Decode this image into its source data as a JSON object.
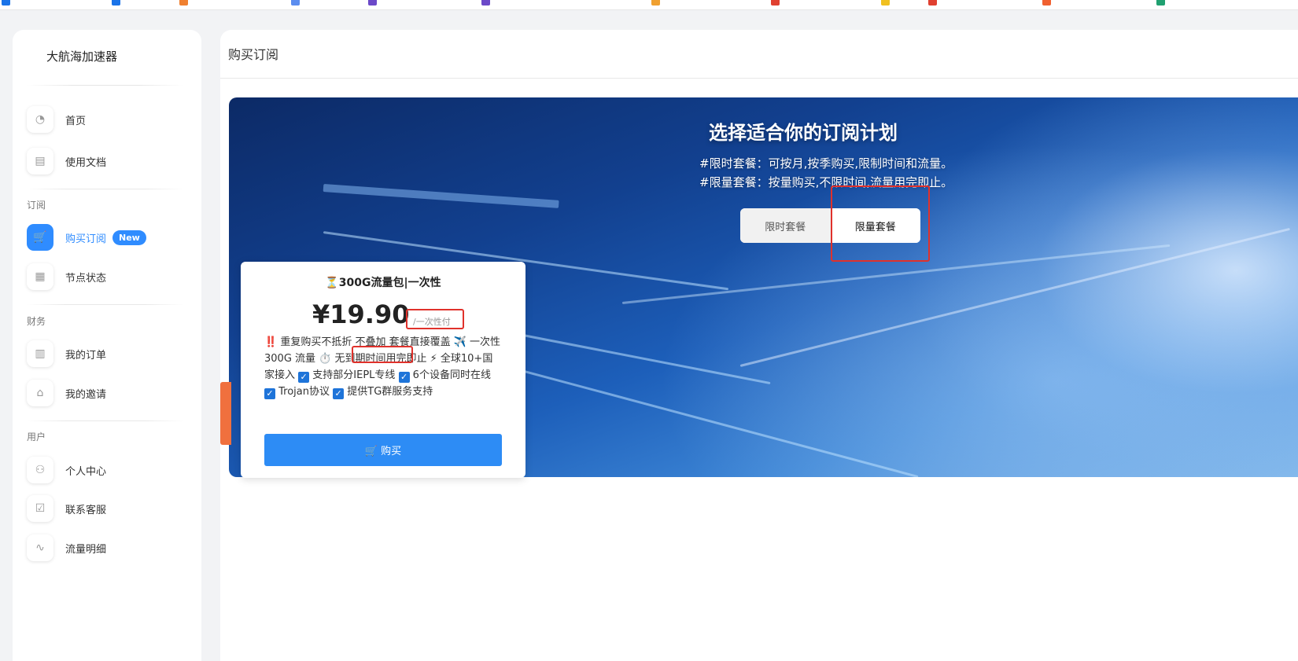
{
  "bookmarks": [
    {
      "color": "#1a73e8"
    },
    {
      "color": "#1a73e8"
    },
    {
      "color": "#f08030"
    },
    {
      "color": "#5b8def"
    },
    {
      "color": "#6b49c8"
    },
    {
      "color": "#6b49c8"
    },
    {
      "color": "#f0a030"
    },
    {
      "color": "#e04030"
    },
    {
      "color": "#f0c020"
    },
    {
      "color": "#e04030"
    },
    {
      "color": "#f06030"
    },
    {
      "color": "#20a070"
    }
  ],
  "sidebar": {
    "brand": "大航海加速器",
    "items_top": [
      {
        "label": "首页",
        "icon": "dashboard-icon",
        "glyph": "◔"
      },
      {
        "label": "使用文档",
        "icon": "document-icon",
        "glyph": "▤"
      }
    ],
    "sections": [
      {
        "title": "订阅",
        "items": [
          {
            "label": "购买订阅",
            "icon": "cart-icon",
            "glyph": "🛒",
            "badge": "New",
            "active": true
          },
          {
            "label": "节点状态",
            "icon": "grid-icon",
            "glyph": "▦"
          }
        ]
      },
      {
        "title": "财务",
        "items": [
          {
            "label": "我的订单",
            "icon": "clipboard-icon",
            "glyph": "▥"
          },
          {
            "label": "我的邀请",
            "icon": "gift-icon",
            "glyph": "⌂"
          }
        ]
      },
      {
        "title": "用户",
        "items": [
          {
            "label": "个人中心",
            "icon": "user-icon",
            "glyph": "⚇"
          },
          {
            "label": "联系客服",
            "icon": "support-icon",
            "glyph": "☑"
          },
          {
            "label": "流量明细",
            "icon": "pulse-icon",
            "glyph": "∿"
          }
        ]
      }
    ]
  },
  "main": {
    "header": "购买订阅",
    "hero": {
      "title": "选择适合你的订阅计划",
      "line1": "#限时套餐：可按月,按季购买,限制时间和流量。",
      "line2": "#限量套餐：按量购买,不限时间,流量用完即止。",
      "toggle_off": "限时套餐",
      "toggle_on": "限量套餐"
    },
    "plan": {
      "title": "⏳300G流量包|一次性",
      "price": "¥19.90",
      "price_unit": "/一次性付",
      "f1": "‼️ 重复购买不抵折 不叠加 套餐直接覆盖 ✈️ 一次性 300G 流量 ⏱️ ",
      "f_highlight": "无到期时间",
      "f2": "用完即止 ⚡ 全球10+国家接入 ",
      "f3": " 支持部分IEPL专线 ",
      "f4": " 6个设备同时在线 ",
      "f5": " Trojan协议 ",
      "f6": " 提供TG群服务支持",
      "buy_label": "🛒 购买"
    }
  },
  "colors": {
    "accent": "#2f8cff",
    "button": "#2d8cf5",
    "highlight_box": "#e0312b"
  }
}
